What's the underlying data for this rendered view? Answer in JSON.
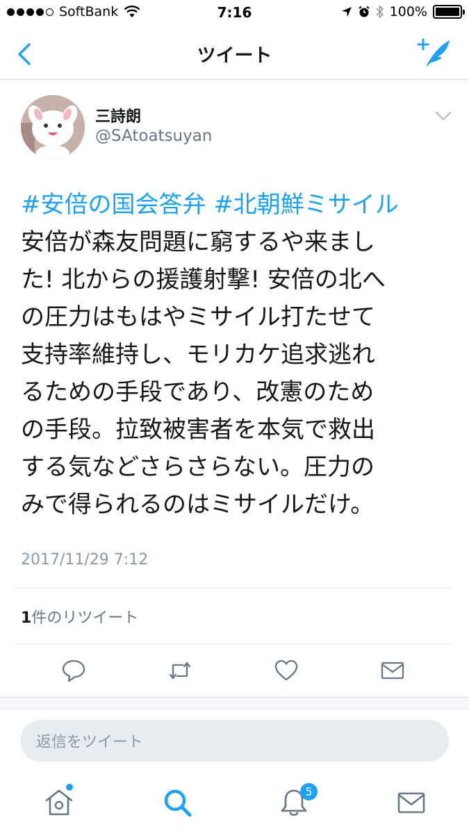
{
  "status_bar": {
    "carrier": "SoftBank",
    "time": "7:16",
    "battery": "100%",
    "battery_level": 1.0,
    "signal_bars": 4,
    "signal_total": 5
  },
  "nav": {
    "title": "ツイート",
    "back_icon": "chevron-left-icon",
    "compose_icon": "compose-tweet-icon"
  },
  "tweet": {
    "display_name": "三詩朗",
    "screen_name": "@SAtoatsuyan",
    "hashtags": [
      "#安倍の国会答弁",
      "#北朝鮮ミサイル"
    ],
    "lines": [
      "安倍が森友問題に窮するや来まし",
      "た! 北からの援護射撃! 安倍の北へ",
      "の圧力はもはやミサイル打たせて",
      "支持率維持し、モリカケ追求逃れ",
      "るための手段であり、改憲のため",
      "の手段。拉致被害者を本気で救出",
      "する気などさらさらない。圧力の",
      "みで得られるのはミサイルだけ。"
    ],
    "timestamp": "2017/11/29 7:12",
    "retweet_number": "1",
    "retweet_label": "件のリツイート"
  },
  "actions": [
    "reply-icon",
    "retweet-icon",
    "like-icon",
    "message-icon"
  ],
  "reply": {
    "placeholder": "返信をツイート"
  },
  "tab_bar": {
    "items": [
      "home-icon",
      "search-icon",
      "notifications-icon",
      "messages-icon"
    ],
    "notification_badge": "5"
  },
  "colors": {
    "accent": "#1da1f2",
    "text": "#14171a",
    "secondary": "#657786",
    "muted": "#8899a6"
  }
}
